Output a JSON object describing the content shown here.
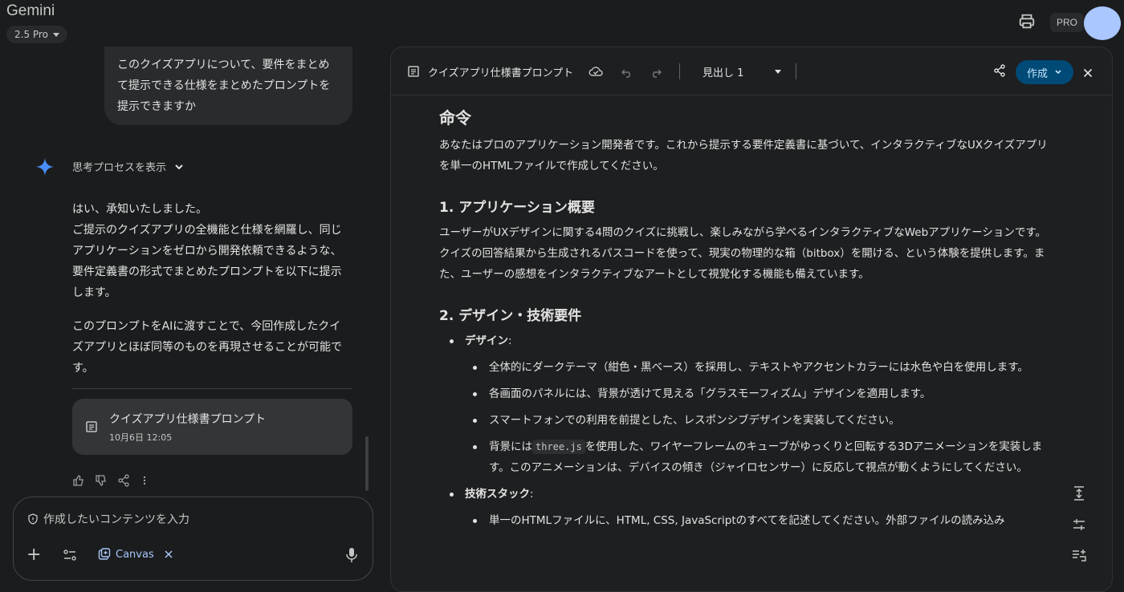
{
  "app": {
    "title": "Gemini",
    "model": "2.5 Pro",
    "pro_badge": "PRO"
  },
  "chat": {
    "user_message": "このクイズアプリについて、要件をまとめて提示できる仕様をまとめたプロンプトを提示できますか",
    "thinking_label": "思考プロセスを表示",
    "response_p1": "はい、承知いたしました。",
    "response_p2": "ご提示のクイズアプリの全機能と仕様を網羅し、同じアプリケーションをゼロから開発依頼できるような、要件定義書の形式でまとめたプロンプトを以下に提示します。",
    "response_p3": "このプロンプトをAIに渡すことで、今回作成したクイズアプリとほぼ同等のものを再現させることが可能です。",
    "doc_card": {
      "title": "クイズアプリ仕様書プロンプト",
      "date": "10月6日 12:05"
    }
  },
  "input": {
    "placeholder": "作成したいコンテンツを入力",
    "canvas_chip": "Canvas"
  },
  "canvas": {
    "title": "クイズアプリ仕様書プロンプト",
    "heading_select": "見出し 1",
    "create_button": "作成",
    "doc": {
      "h_command": "命令",
      "p_command": "あなたはプロのアプリケーション開発者です。これから提示する要件定義書に基づいて、インタラクティブなUXクイズアプリを単一のHTMLファイルで作成してください。",
      "h_overview": "1. アプリケーション概要",
      "p_overview": "ユーザーがUXデザインに関する4問のクイズに挑戦し、楽しみながら学べるインタラクティブなWebアプリケーションです。クイズの回答結果から生成されるパスコードを使って、現実の物理的な箱（bitbox）を開ける、という体験を提供します。また、ユーザーの感想をインタラクティブなアートとして視覚化する機能も備えています。",
      "h_design": "2. デザイン・技術要件",
      "design_label": "デザイン",
      "design_items": [
        "全体的にダークテーマ（紺色・黒ベース）を採用し、テキストやアクセントカラーには水色や白を使用します。",
        "各画面のパネルには、背景が透けて見える「グラスモーフィズム」デザインを適用します。",
        "スマートフォンでの利用を前提とした、レスポンシブデザインを実装してください。"
      ],
      "design_item4_pre": "背景には",
      "design_item4_code": "three.js",
      "design_item4_post": "を使用した、ワイヤーフレームのキューブがゆっくりと回転する3Dアニメーションを実装します。このアニメーションは、デバイスの傾き（ジャイロセンサー）に反応して視点が動くようにしてください。",
      "tech_label": "技術スタック",
      "tech_item1": "単一のHTMLファイルに、HTML, CSS, JavaScriptのすべてを記述してください。外部ファイルの読み込み"
    }
  },
  "colors": {
    "accent": "#a8c7fa",
    "create_button_bg": "#004a77",
    "avatar": "#aac7ff"
  }
}
